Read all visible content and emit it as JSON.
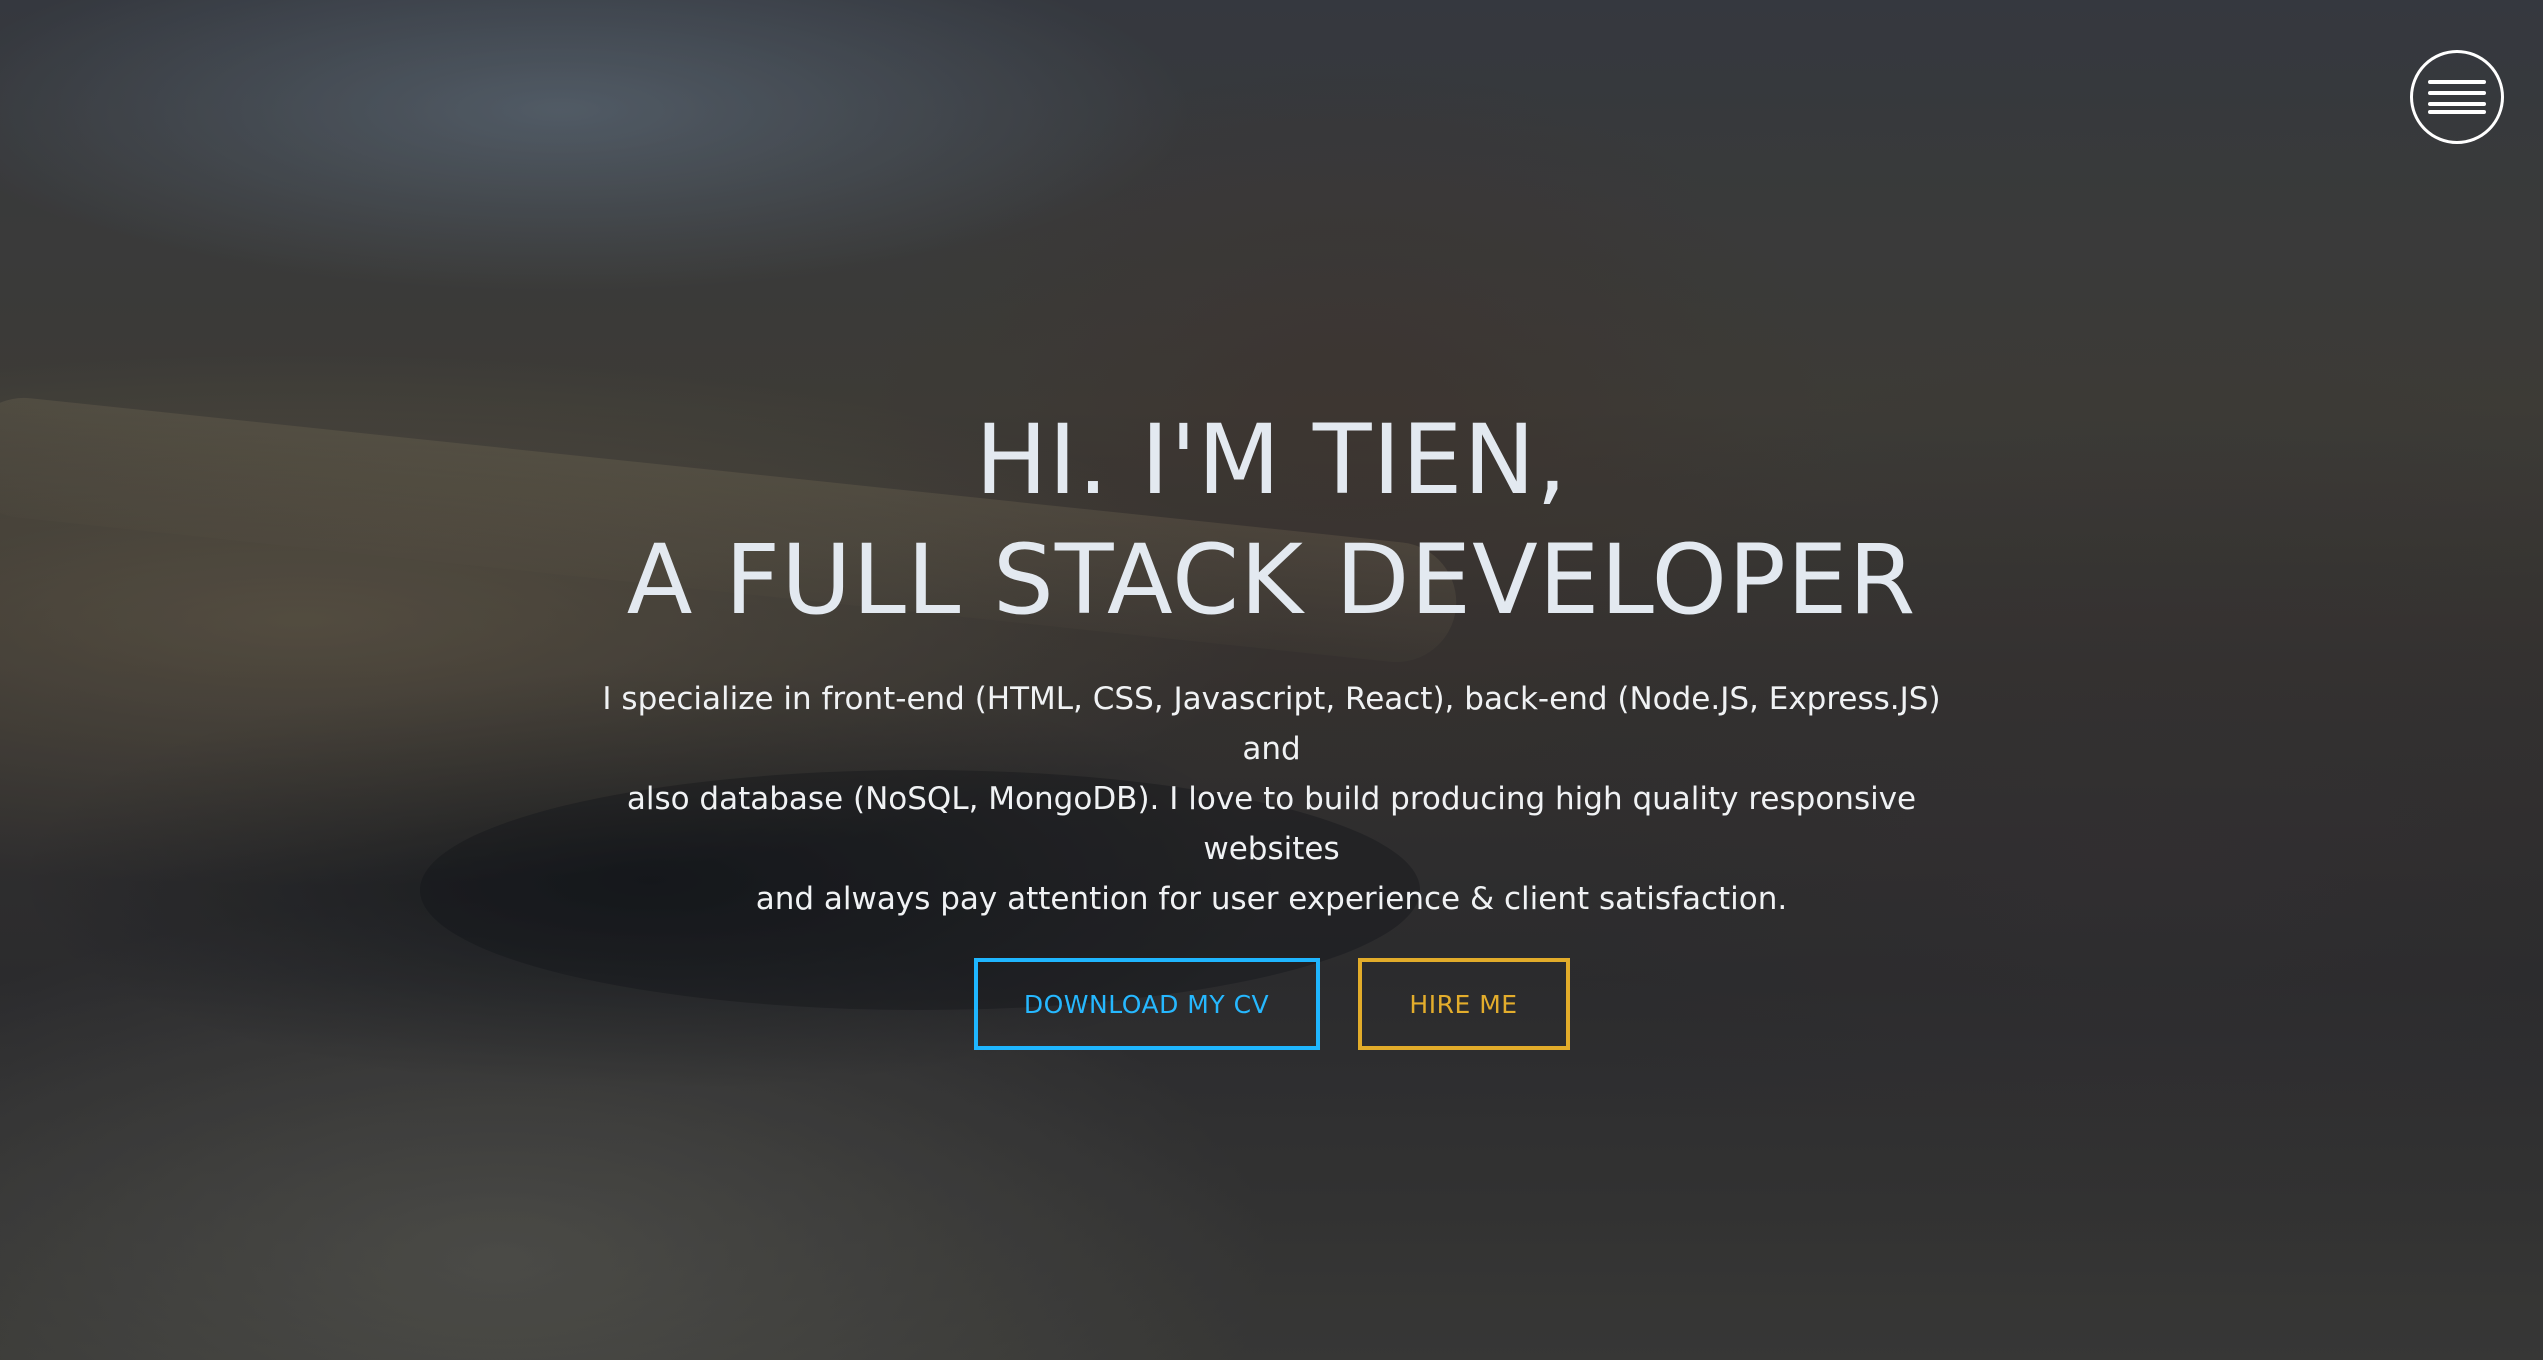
{
  "header": {
    "menu_icon": "hamburger-menu-icon"
  },
  "hero": {
    "headline_line1": "HI. I'M TIEN,",
    "headline_line2": "A FULL STACK DEVELOPER",
    "intro_line1": "I specialize in front-end (HTML, CSS, Javascript, React), back-end (Node.JS, Express.JS) and",
    "intro_line2": "also database (NoSQL, MongoDB). I love to build producing high quality responsive websites",
    "intro_line3": "and always pay attention for user experience & client satisfaction.",
    "download_cv_label": "DOWNLOAD MY CV",
    "hire_me_label": "HIRE ME"
  },
  "colors": {
    "cv_accent": "#1fb6ff",
    "hire_accent": "#e2ac2a",
    "headline": "#e3e9f0"
  }
}
